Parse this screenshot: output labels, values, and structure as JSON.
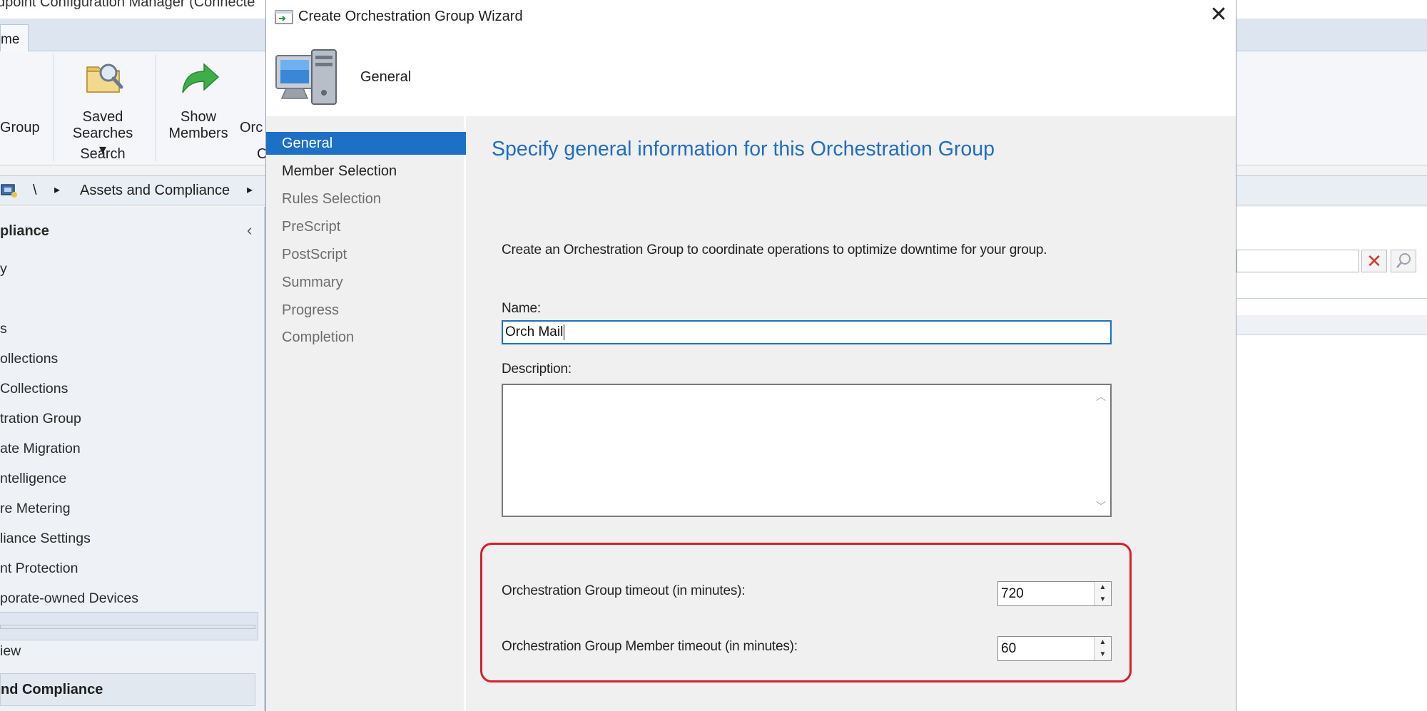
{
  "background_app": {
    "title_fragment": "dpoint Configuration Manager (Connecte",
    "home_tab": "me",
    "ribbon": {
      "group_button_label": "Group",
      "saved_searches_line1": "Saved",
      "saved_searches_line2": "Searches ▾",
      "search_group_label": "Search",
      "show_members_line1": "Show",
      "show_members_line2": "Members",
      "orch_fragment": "Orc",
      "c_fragment": "C"
    },
    "address_bar": {
      "root": "\\",
      "sep1": "▸",
      "crumb": "Assets and Compliance",
      "sep2": "▸"
    },
    "nav": {
      "header": "pliance",
      "collapse_glyph": "‹",
      "items": [
        "y",
        "",
        "s",
        "ollections",
        " Collections",
        "tration Group",
        "ate Migration",
        "ntelligence",
        "re Metering",
        "liance Settings",
        "nt Protection",
        "porate-owned Devices"
      ],
      "selected_index": 5,
      "bottom_item": "iew",
      "bottom_section": "nd Compliance"
    }
  },
  "dialog": {
    "title": "Create Orchestration Group Wizard",
    "close_glyph": "✕",
    "header_label": "General",
    "steps": [
      "General",
      "Member Selection",
      "Rules Selection",
      "PreScript",
      "PostScript",
      "Summary",
      "Progress",
      "Completion"
    ],
    "active_step": 0,
    "heading": "Specify general information for this Orchestration Group",
    "intro": "Create an Orchestration Group to coordinate operations to optimize downtime for your group.",
    "name_label": "Name:",
    "name_value": "Orch Mail",
    "description_label": "Description:",
    "description_value": "",
    "group_timeout_label": "Orchestration Group timeout (in minutes):",
    "group_timeout_value": "720",
    "member_timeout_label": "Orchestration Group Member timeout (in minutes):",
    "member_timeout_value": "60"
  },
  "colors": {
    "accent": "#1e70c6",
    "heading": "#1f6ec1",
    "highlight": "#d81e2c"
  }
}
